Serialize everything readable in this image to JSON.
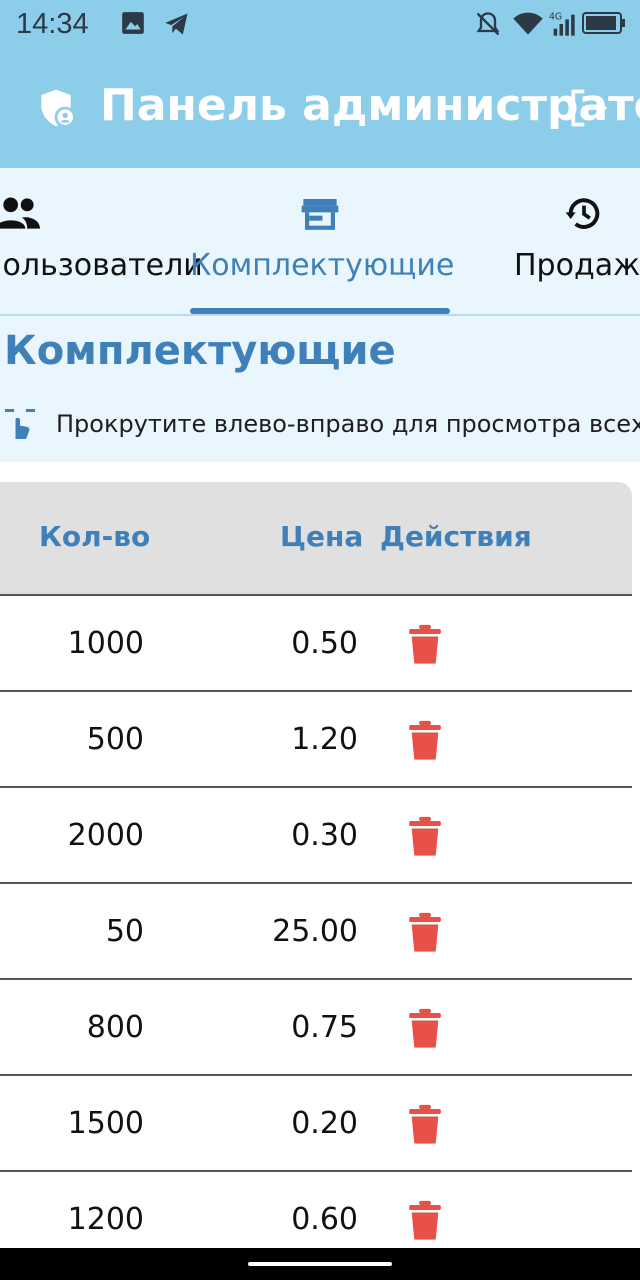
{
  "status_bar": {
    "time": "14:34",
    "icons": [
      "image-icon",
      "telegram-icon",
      "mute-icon",
      "wifi-icon",
      "signal-4g-icon",
      "battery-icon"
    ]
  },
  "app_bar": {
    "title": "Панель администратора",
    "icons": [
      "admin-shield-icon",
      "logout-icon"
    ]
  },
  "tabs": [
    {
      "label": "Пользователи",
      "icon": "users-icon",
      "active": false
    },
    {
      "label": "Комплектующие",
      "icon": "store-icon",
      "active": true
    },
    {
      "label": "Продажи",
      "icon": "history-icon",
      "active": false
    }
  ],
  "section": {
    "title": "Комплектующие",
    "hint": "Прокрутите влево-вправо для просмотра всех колонок"
  },
  "table": {
    "columns": {
      "qty": "Кол-во",
      "price": "Цена",
      "actions": "Действия"
    },
    "rows": [
      {
        "qty": "1000",
        "price": "0.50"
      },
      {
        "qty": "500",
        "price": "1.20"
      },
      {
        "qty": "2000",
        "price": "0.30"
      },
      {
        "qty": "50",
        "price": "25.00"
      },
      {
        "qty": "800",
        "price": "0.75"
      },
      {
        "qty": "1500",
        "price": "0.20"
      },
      {
        "qty": "1200",
        "price": "0.60"
      }
    ]
  },
  "colors": {
    "app_bar": "#8ccdea",
    "tab_background": "#eaf6fd",
    "accent": "#3f80b8",
    "delete": "#e8504a",
    "table_header": "#e0e0e0"
  }
}
